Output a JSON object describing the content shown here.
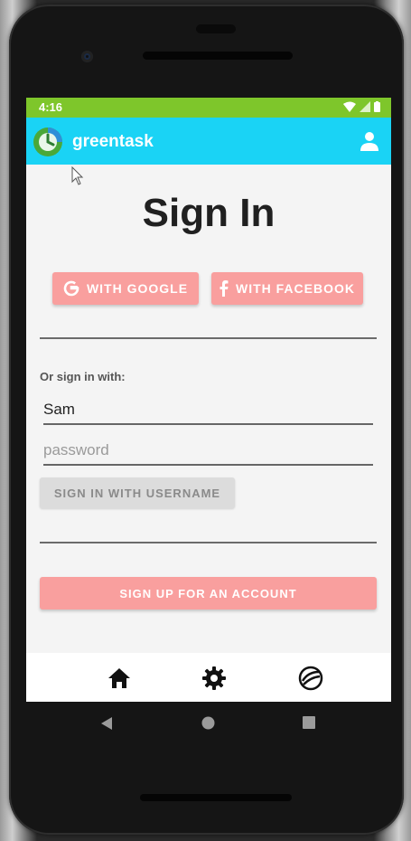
{
  "status_bar": {
    "time": "4:16",
    "color": "#7ec62b"
  },
  "app_bar": {
    "title": "greentask",
    "logo_icon": "clock-logo",
    "account_icon": "person-icon",
    "color": "#1ad3f5"
  },
  "sign_in": {
    "title": "Sign In",
    "google_label": "WITH GOOGLE",
    "facebook_label": "WITH FACEBOOK",
    "or_label": "Or sign in with:",
    "username_value": "Sam",
    "password_placeholder": "password",
    "username_button_label": "SIGN IN WITH USERNAME",
    "signup_label": "SIGN UP FOR AN ACCOUNT",
    "accent_color": "#f99f9e"
  },
  "bottom_nav": {
    "items": [
      "home-icon",
      "settings-icon",
      "sync-icon"
    ]
  },
  "system_nav": {
    "items": [
      "back-icon",
      "home-circle-icon",
      "recent-apps-icon"
    ]
  }
}
